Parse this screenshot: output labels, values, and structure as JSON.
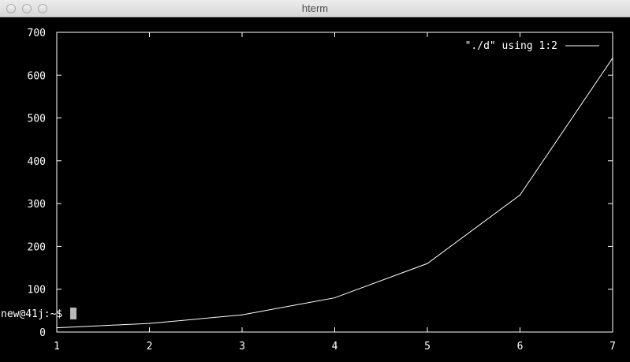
{
  "window": {
    "title": "hterm"
  },
  "terminal": {
    "prompt": "new@41j:~$ "
  },
  "chart_data": {
    "type": "line",
    "x": [
      1,
      2,
      3,
      4,
      5,
      6,
      7
    ],
    "series": [
      {
        "name": "\"./d\" using 1:2",
        "values": [
          10,
          20,
          40,
          80,
          160,
          320,
          640
        ]
      }
    ],
    "xlim": [
      1,
      7
    ],
    "ylim": [
      0,
      700
    ],
    "xticks": [
      "1",
      "2",
      "3",
      "4",
      "5",
      "6",
      "7"
    ],
    "yticks": [
      "0",
      "100",
      "200",
      "300",
      "400",
      "500",
      "600",
      "700"
    ],
    "legend": "top-right",
    "grid": false,
    "colors": {
      "background": "#000000",
      "foreground": "#ffffff"
    }
  }
}
